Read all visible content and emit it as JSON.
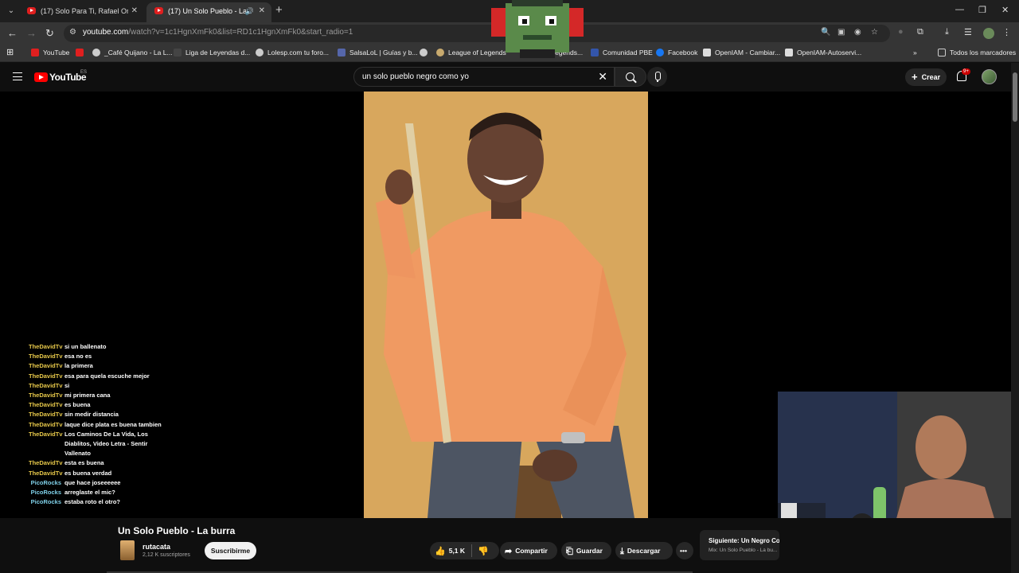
{
  "browser": {
    "tabs": [
      {
        "title": "(17) Solo Para Ti, Rafael Orozco",
        "active": false
      },
      {
        "title": "(17) Un Solo Pueblo - La burra",
        "active": true
      }
    ],
    "url_host": "youtube.com",
    "url_path": "/watch?v=1c1HgnXmFk0&list=RD1c1HgnXmFk0&start_radio=1",
    "bookmarks": [
      {
        "label": "YouTube",
        "color": "#e01f1f"
      },
      {
        "label": "",
        "color": "#e01f1f"
      },
      {
        "label": "_Café Quijano - La L...",
        "color": "#cccccc"
      },
      {
        "label": "Liga de Leyendas d...",
        "color": "#444444"
      },
      {
        "label": "Lolesp.com tu foro...",
        "color": "#cccccc"
      },
      {
        "label": "SalsaLoL | Guías y b...",
        "color": "#5566aa"
      },
      {
        "label": "",
        "color": "#cccccc"
      },
      {
        "label": "League of Legends",
        "color": "#c8aa6e"
      },
      {
        "label": "...egends...",
        "color": "#444444"
      },
      {
        "label": "Comunidad PBE",
        "color": "#3355aa"
      },
      {
        "label": "Facebook",
        "color": "#1877f2"
      },
      {
        "label": "OpenIAM - Cambiar...",
        "color": "#dddddd"
      },
      {
        "label": "OpenIAM-Autoservi...",
        "color": "#dddddd"
      }
    ],
    "all_bookmarks_label": "Todos los marcadores"
  },
  "youtube": {
    "logo_text": "YouTube",
    "region": "ES",
    "search_query": "un solo pueblo negro como yo",
    "create_label": "Crear",
    "notif_count": "9+"
  },
  "chat": [
    {
      "user": "TheDavidTv",
      "msg": "si un ballenato",
      "color": "#e8c94a"
    },
    {
      "user": "TheDavidTv",
      "msg": "esa no es",
      "color": "#e8c94a"
    },
    {
      "user": "TheDavidTv",
      "msg": "la primera",
      "color": "#e8c94a"
    },
    {
      "user": "TheDavidTv",
      "msg": "esa para quela escuche mejor",
      "color": "#e8c94a"
    },
    {
      "user": "TheDavidTv",
      "msg": "si",
      "color": "#e8c94a"
    },
    {
      "user": "TheDavidTv",
      "msg": "mi primera cana",
      "color": "#e8c94a"
    },
    {
      "user": "TheDavidTv",
      "msg": "es buena",
      "color": "#e8c94a"
    },
    {
      "user": "TheDavidTv",
      "msg": "sin medir distancia",
      "color": "#e8c94a"
    },
    {
      "user": "TheDavidTv",
      "msg": "laque dice plata es buena tambien",
      "color": "#e8c94a"
    },
    {
      "user": "TheDavidTv",
      "msg": "Los Caminos De La Vida, Los Diablitos, Video Letra - Sentir Vallenato",
      "color": "#e8c94a"
    },
    {
      "user": "TheDavidTv",
      "msg": "esta es buena",
      "color": "#e8c94a"
    },
    {
      "user": "TheDavidTv",
      "msg": "es buena verdad",
      "color": "#e8c94a"
    },
    {
      "user": "PicoRocks",
      "msg": "que hace joseeeeee",
      "color": "#7fd0e8"
    },
    {
      "user": "PicoRocks",
      "msg": "arreglaste el mic?",
      "color": "#7fd0e8"
    },
    {
      "user": "PicoRocks",
      "msg": "estaba roto el otro?",
      "color": "#7fd0e8"
    }
  ],
  "video": {
    "title": "Un Solo Pueblo - La burra",
    "channel": "rutacata",
    "subscribers": "2,12 K suscriptores",
    "subscribe_label": "Suscribirme",
    "likes": "5,1 K",
    "share_label": "Compartir",
    "save_label": "Guardar",
    "download_label": "Descargar"
  },
  "next": {
    "title": "Siguiente: Un Negro Co...",
    "subtitle": "Mix: Un Solo Pueblo - La bu..."
  }
}
